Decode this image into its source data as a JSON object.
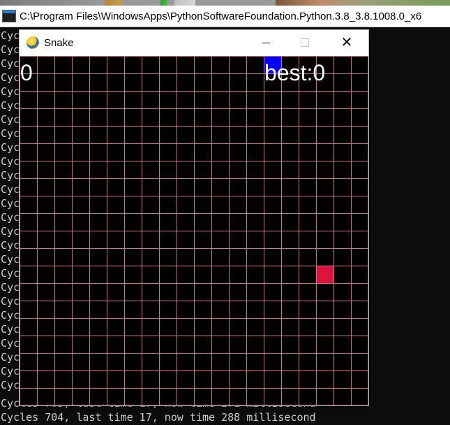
{
  "console": {
    "title": "C:\\Program Files\\WindowsApps\\PythonSoftwareFoundation.Python.3.8_3.8.1008.0_x6",
    "line_prefix": "Cyc",
    "partial_line": "Cycles 703, last time 17, now time 271 millisecond",
    "last_line": "Cycles 704, last time 17, now time 288 millisecond"
  },
  "snake_window": {
    "title": "Snake",
    "minimize_label": "—",
    "maximize_label": "☐",
    "close_label": "✕"
  },
  "game": {
    "score": "0",
    "best": "best:0",
    "grid_cols": 20,
    "grid_rows": 20,
    "grid_color": "#c8708a",
    "background_color": "#000000",
    "snake_head": {
      "col": 14,
      "row": 0,
      "color": "#0000ff"
    },
    "food": {
      "col": 17,
      "row": 12,
      "color": "#dc143c"
    }
  }
}
